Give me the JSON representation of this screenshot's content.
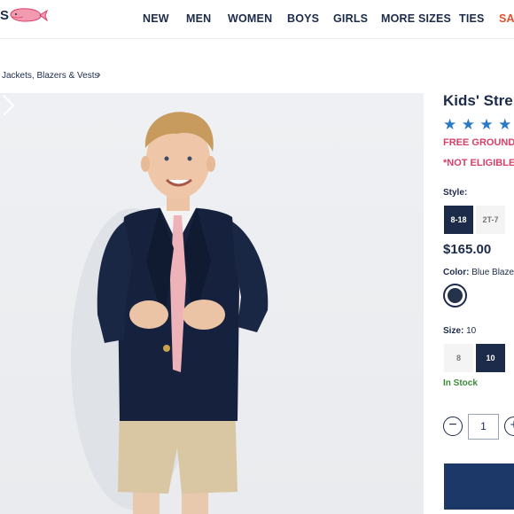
{
  "header": {
    "logo_partial": "S",
    "nav": [
      "NEW",
      "MEN",
      "WOMEN",
      "BOYS",
      "GIRLS",
      "MORE SIZES",
      "TIES",
      "SA"
    ]
  },
  "breadcrumb": {
    "text": "Jackets, Blazers & Vests",
    "chevron": "›"
  },
  "product": {
    "title": "Kids' Stre",
    "rating_stars": 5,
    "star_glyph": "★",
    "promo_shipping": "FREE GROUND",
    "promo_eligibility": "*NOT ELIGIBLE",
    "style_label": "Style:",
    "style_options": [
      "8-18",
      "2T-7"
    ],
    "price": "$165.00",
    "color_label": "Color:",
    "color_value": "Blue Blazer",
    "size_label": "Size:",
    "size_value": "10",
    "size_options": [
      "8",
      "10"
    ],
    "stock_status": "In Stock",
    "quantity": "1",
    "qty_minus": "−",
    "qty_plus": "+"
  },
  "colors": {
    "navy": "#1c2b4a",
    "star_blue": "#2a79c4",
    "promo_pink": "#d9406a",
    "sale_orange": "#e0502f",
    "stock_green": "#3a8c3a"
  }
}
